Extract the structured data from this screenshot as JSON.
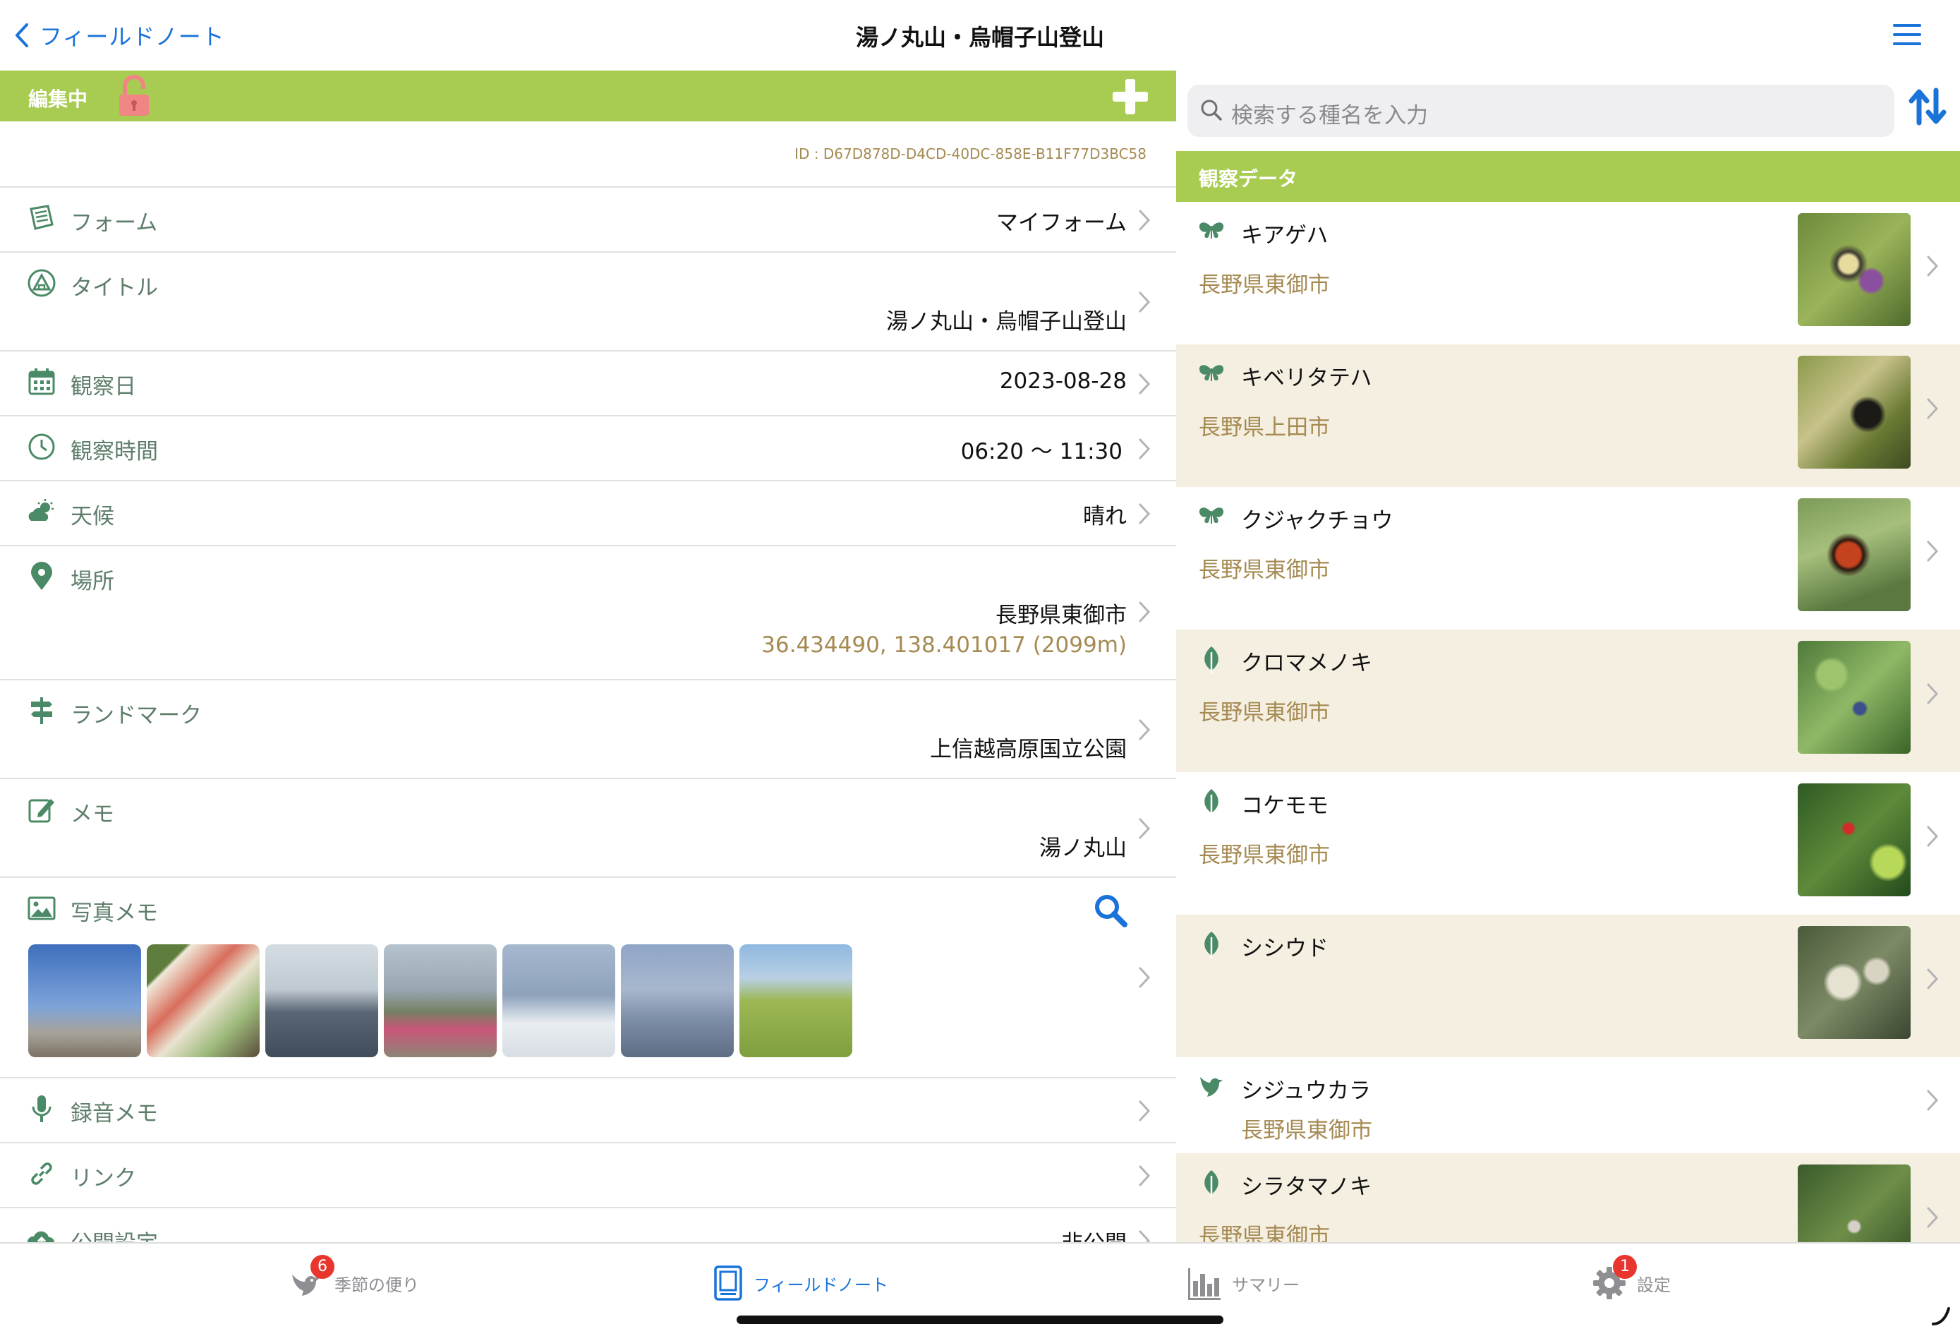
{
  "nav": {
    "back_label": "フィールドノート",
    "title": "湯ノ丸山・烏帽子山登山"
  },
  "left": {
    "edit_status": "編集中",
    "record_id": "ID : D67D878D-D4CD-40DC-858E-B11F77D3BC58",
    "rows": {
      "form": {
        "label": "フォーム",
        "value": "マイフォーム"
      },
      "title": {
        "label": "タイトル",
        "value": "湯ノ丸山・烏帽子山登山"
      },
      "date": {
        "label": "観察日",
        "value": "2023-08-28"
      },
      "time": {
        "label": "観察時間",
        "value": "06:20 〜 11:30"
      },
      "weather": {
        "label": "天候",
        "value": "晴れ"
      },
      "place": {
        "label": "場所",
        "value": "長野県東御市",
        "coords": "36.434490, 138.401017 (2099m)"
      },
      "landmark": {
        "label": "ランドマーク",
        "value": "上信越高原国立公園"
      },
      "memo": {
        "label": "メモ",
        "value": "湯ノ丸山"
      },
      "photo": {
        "label": "写真メモ"
      },
      "audio": {
        "label": "録音メモ"
      },
      "link": {
        "label": "リンク"
      },
      "visibility": {
        "label": "公開設定",
        "value": "非公開"
      }
    }
  },
  "right": {
    "search_placeholder": "検索する種名を入力",
    "section_title": "観察データ",
    "observations": [
      {
        "name": "キアゲハ",
        "location": "長野県東御市",
        "type": "butterfly-icon"
      },
      {
        "name": "キベリタテハ",
        "location": "長野県上田市",
        "type": "butterfly-icon"
      },
      {
        "name": "クジャクチョウ",
        "location": "長野県東御市",
        "type": "butterfly-icon"
      },
      {
        "name": "クロマメノキ",
        "location": "長野県東御市",
        "type": "leaf-icon"
      },
      {
        "name": "コケモモ",
        "location": "長野県東御市",
        "type": "leaf-icon"
      },
      {
        "name": "シシウド",
        "location": "",
        "type": "leaf-icon"
      },
      {
        "name": "シジュウカラ",
        "location": "長野県東御市",
        "type": "bird-icon"
      },
      {
        "name": "シラタマノキ",
        "location": "長野県東御市",
        "type": "leaf-icon"
      }
    ]
  },
  "tabs": {
    "season": {
      "label": "季節の便り",
      "badge": "6"
    },
    "fieldnote": {
      "label": "フィールドノート"
    },
    "summary": {
      "label": "サマリー"
    },
    "settings": {
      "label": "設定",
      "badge": "1"
    }
  },
  "colors": {
    "accent_green": "#a8cc52",
    "link_blue": "#1a73d9",
    "brown_text": "#a58a52",
    "icon_green": "#4a8a66",
    "alt_row": "#f5efe1"
  }
}
